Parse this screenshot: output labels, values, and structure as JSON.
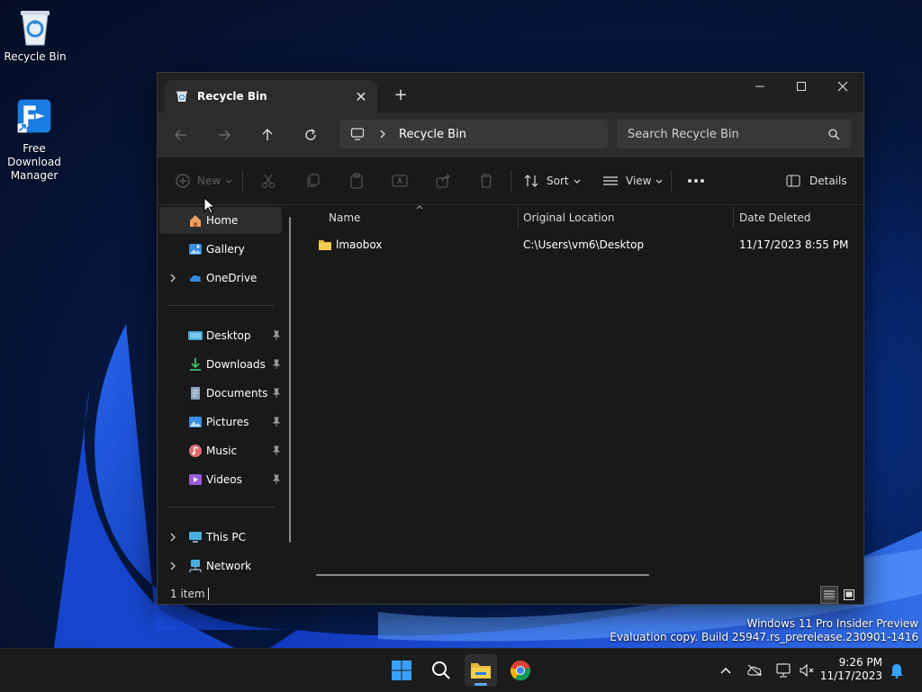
{
  "desktop": {
    "icons": [
      {
        "label": "Recycle Bin"
      },
      {
        "label": "Free Download Manager"
      }
    ],
    "watermark": {
      "line1": "Windows 11 Pro Insider Preview",
      "line2": "Evaluation copy. Build 25947.rs_prerelease.230901-1416"
    }
  },
  "window": {
    "tab_title": "Recycle Bin",
    "breadcrumb": "Recycle Bin",
    "search_placeholder": "Search Recycle Bin",
    "toolbar": {
      "new_label": "New",
      "sort_label": "Sort",
      "view_label": "View",
      "details_label": "Details"
    },
    "sidebar": {
      "items": [
        {
          "label": "Home"
        },
        {
          "label": "Gallery"
        },
        {
          "label": "OneDrive"
        },
        {
          "label": "Desktop"
        },
        {
          "label": "Downloads"
        },
        {
          "label": "Documents"
        },
        {
          "label": "Pictures"
        },
        {
          "label": "Music"
        },
        {
          "label": "Videos"
        },
        {
          "label": "This PC"
        },
        {
          "label": "Network"
        }
      ]
    },
    "columns": [
      "Name",
      "Original Location",
      "Date Deleted"
    ],
    "files": [
      {
        "name": "lmaobox",
        "location": "C:\\Users\\vm6\\Desktop",
        "date": "11/17/2023 8:55 PM"
      }
    ],
    "status": "1 item"
  },
  "taskbar": {
    "time": "9:26 PM",
    "date": "11/17/2023"
  },
  "colors": {
    "window_bg": "#191919",
    "navbar_bg": "#2c2c2c",
    "accent": "#0a64d8",
    "folder": "#e8b838"
  }
}
